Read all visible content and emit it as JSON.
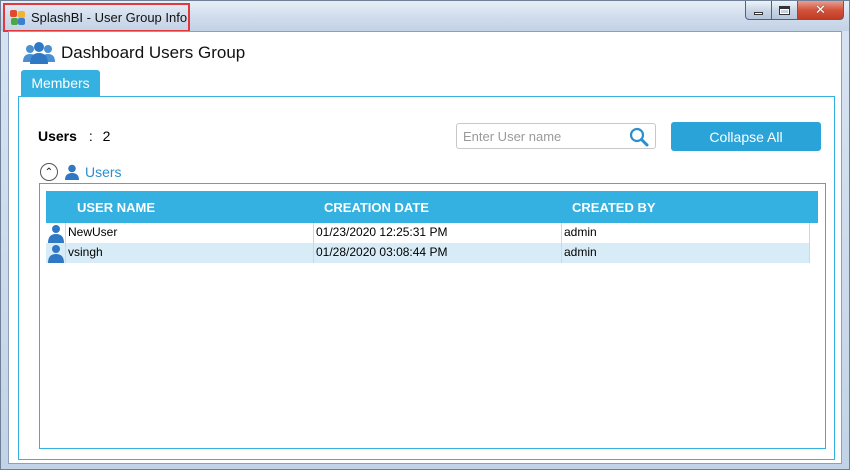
{
  "window": {
    "title": "SplashBI - User Group Info",
    "close_glyph": "✕"
  },
  "header": {
    "title": "Dashboard Users Group",
    "icon": "users-group-icon"
  },
  "tabs": [
    {
      "label": "Members"
    }
  ],
  "members": {
    "users_label": "Users",
    "users_separator": ":",
    "users_count": "2",
    "search": {
      "placeholder": "Enter User name",
      "value": ""
    },
    "collapse_button": "Collapse All",
    "group": {
      "label": "Users",
      "toggle_glyph": "⌃"
    },
    "table": {
      "columns": [
        "USER NAME",
        "CREATION DATE",
        "CREATED BY"
      ],
      "rows": [
        {
          "user_name": "NewUser",
          "creation_date": "01/23/2020 12:25:31 PM",
          "created_by": "admin"
        },
        {
          "user_name": "vsingh",
          "creation_date": "01/28/2020 03:08:44 PM",
          "created_by": "admin"
        }
      ]
    }
  },
  "colors": {
    "accent": "#34b0e1",
    "button": "#2aa3d9",
    "selected_row": "#d8ecf7",
    "group_label": "#2a8fcd",
    "highlight_border": "#e0393c"
  }
}
